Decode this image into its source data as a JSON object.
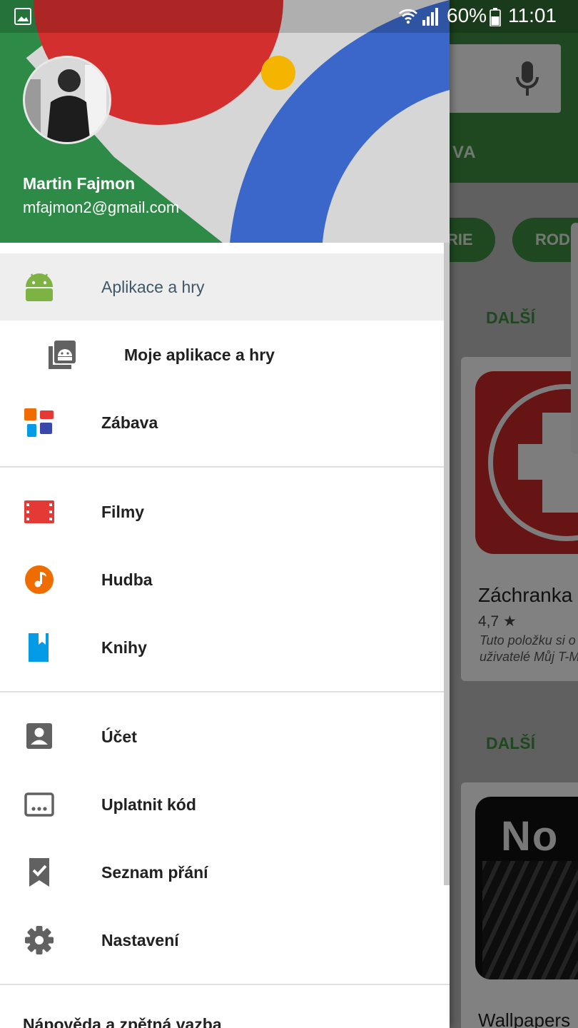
{
  "status_bar": {
    "battery": "60%",
    "time": "11:01"
  },
  "background": {
    "tab_fragment": "VA",
    "chips": [
      "RIE",
      "RODI"
    ],
    "more_label": "DALŠÍ",
    "app1": {
      "name": "Záchranka",
      "rating": "4,7 ★",
      "note_line1": "Tuto položku si o",
      "note_line2": "uživatelé Můj T-M"
    },
    "app2": {
      "logo": "No",
      "name": "Wallpapers"
    }
  },
  "user": {
    "name": "Martin Fajmon",
    "email": "mfajmon2@gmail.com"
  },
  "menu": {
    "apps_games": "Aplikace a hry",
    "my_apps": "Moje aplikace a hry",
    "entertainment": "Zábava",
    "movies": "Filmy",
    "music": "Hudba",
    "books": "Knihy",
    "account": "Účet",
    "redeem": "Uplatnit kód",
    "wishlist": "Seznam přání",
    "settings": "Nastavení",
    "help": "Nápověda a zpětná vazba"
  },
  "colors": {
    "android_green": "#7cb342",
    "movies_red": "#e53935",
    "music_orange": "#ef6c00",
    "books_blue": "#039be5",
    "icon_grey": "#616161",
    "selected_text": "#3f5866"
  }
}
